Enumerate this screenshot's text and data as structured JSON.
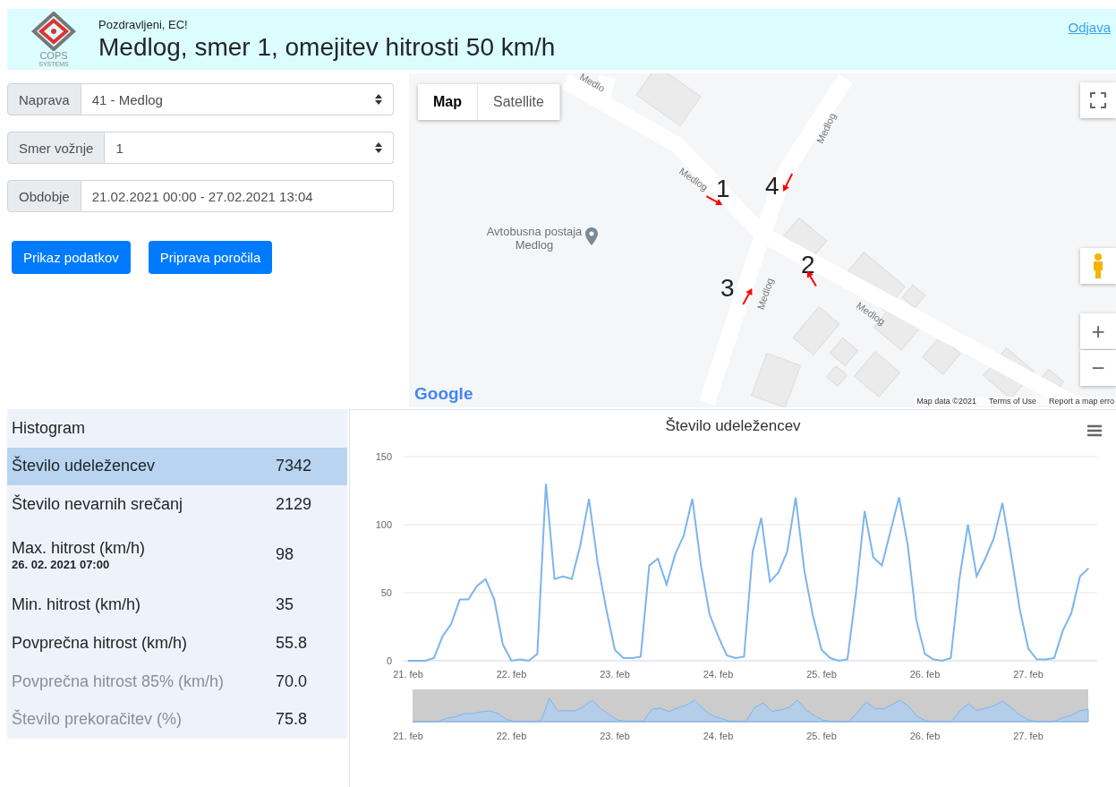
{
  "header": {
    "logo_text": [
      "COPS",
      "SYSTEMS"
    ],
    "greeting": "Pozdravljeni, EC!",
    "title": "Medlog, smer 1, omejitev hitrosti 50 km/h",
    "logout": "Odjava"
  },
  "form": {
    "fields": [
      {
        "kind": "select",
        "label": "Naprava",
        "value": "41 - Medlog"
      },
      {
        "kind": "select",
        "label": "Smer vožnje",
        "value": "1"
      },
      {
        "kind": "input",
        "label": "Obdobje",
        "value": "21.02.2021 00:00 - 27.02.2021 13:04"
      }
    ],
    "buttons": [
      "Prikaz podatkov",
      "Priprava poročila"
    ]
  },
  "map": {
    "map_types": [
      {
        "label": "Map",
        "selected": true
      },
      {
        "label": "Satellite",
        "selected": false
      }
    ],
    "road_labels": [
      "Medlo",
      "Medlog",
      "Medlog",
      "Medlog",
      "Medlog"
    ],
    "place_label": "Avtobusna postaja Medlog",
    "markers": [
      {
        "label": "1"
      },
      {
        "label": "2"
      },
      {
        "label": "3"
      },
      {
        "label": "4"
      }
    ],
    "logo": "Google",
    "footer": [
      "Map data ©2021",
      "Terms of Use",
      "Report a map erro"
    ],
    "zoom_in": "+",
    "zoom_out": "−"
  },
  "stats": {
    "title": "Histogram",
    "rows": [
      {
        "label": "Število udeležencev",
        "value": "7342",
        "selected": true,
        "disabled": false
      },
      {
        "label": "Število nevarnih srečanj",
        "value": "2129",
        "selected": false,
        "disabled": false
      },
      {
        "label": "Max. hitrost (km/h)",
        "sub": "26. 02. 2021 07:00",
        "value": "98",
        "selected": false,
        "disabled": false
      },
      {
        "label": "Min. hitrost (km/h)",
        "value": "35",
        "selected": false,
        "disabled": false
      },
      {
        "label": "Povprečna hitrost (km/h)",
        "value": "55.8",
        "selected": false,
        "disabled": false
      },
      {
        "label": "Povprečna hitrost 85% (km/h)",
        "value": "70.0",
        "selected": false,
        "disabled": true
      },
      {
        "label": "Število prekoračitev (%)",
        "value": "75.8",
        "selected": false,
        "disabled": true
      }
    ]
  },
  "chart": {
    "chart_data": {
      "type": "line",
      "title": "Število udeležencev",
      "categories": [
        "21. feb",
        null,
        null,
        null,
        null,
        null,
        null,
        null,
        null,
        null,
        null,
        null,
        "22. feb",
        null,
        null,
        null,
        null,
        null,
        null,
        null,
        null,
        null,
        null,
        null,
        "23. feb",
        null,
        null,
        null,
        null,
        null,
        null,
        null,
        null,
        null,
        null,
        null,
        "24. feb",
        null,
        null,
        null,
        null,
        null,
        null,
        null,
        null,
        null,
        null,
        null,
        "25. feb",
        null,
        null,
        null,
        null,
        null,
        null,
        null,
        null,
        null,
        null,
        null,
        "26. feb",
        null,
        null,
        null,
        null,
        null,
        null,
        null,
        null,
        null,
        null,
        null,
        "27. feb",
        null,
        null,
        null,
        null,
        null,
        null,
        null
      ],
      "series": [
        {
          "color": "#7cb5ec",
          "values": [
            0,
            0,
            0,
            2,
            18,
            27,
            45,
            45,
            55,
            60,
            45,
            12,
            0,
            1,
            0,
            5,
            130,
            60,
            62,
            60,
            85,
            119,
            72,
            38,
            8,
            2,
            2,
            3,
            70,
            75,
            56,
            78,
            92,
            119,
            70,
            34,
            18,
            4,
            2,
            3,
            80,
            105,
            58,
            65,
            80,
            120,
            66,
            33,
            8,
            2,
            0,
            1,
            50,
            110,
            76,
            70,
            95,
            120,
            85,
            30,
            5,
            1,
            0,
            2,
            60,
            100,
            62,
            75,
            90,
            116,
            78,
            38,
            9,
            1,
            1,
            2,
            22,
            35,
            62,
            68
          ]
        }
      ],
      "ylim": [
        0,
        150
      ],
      "yticks": [
        0,
        50,
        100,
        150
      ]
    },
    "navigator_labels": [
      "21. feb",
      "22. feb",
      "23. feb",
      "24. feb",
      "25. feb",
      "26. feb",
      "27. feb"
    ]
  }
}
